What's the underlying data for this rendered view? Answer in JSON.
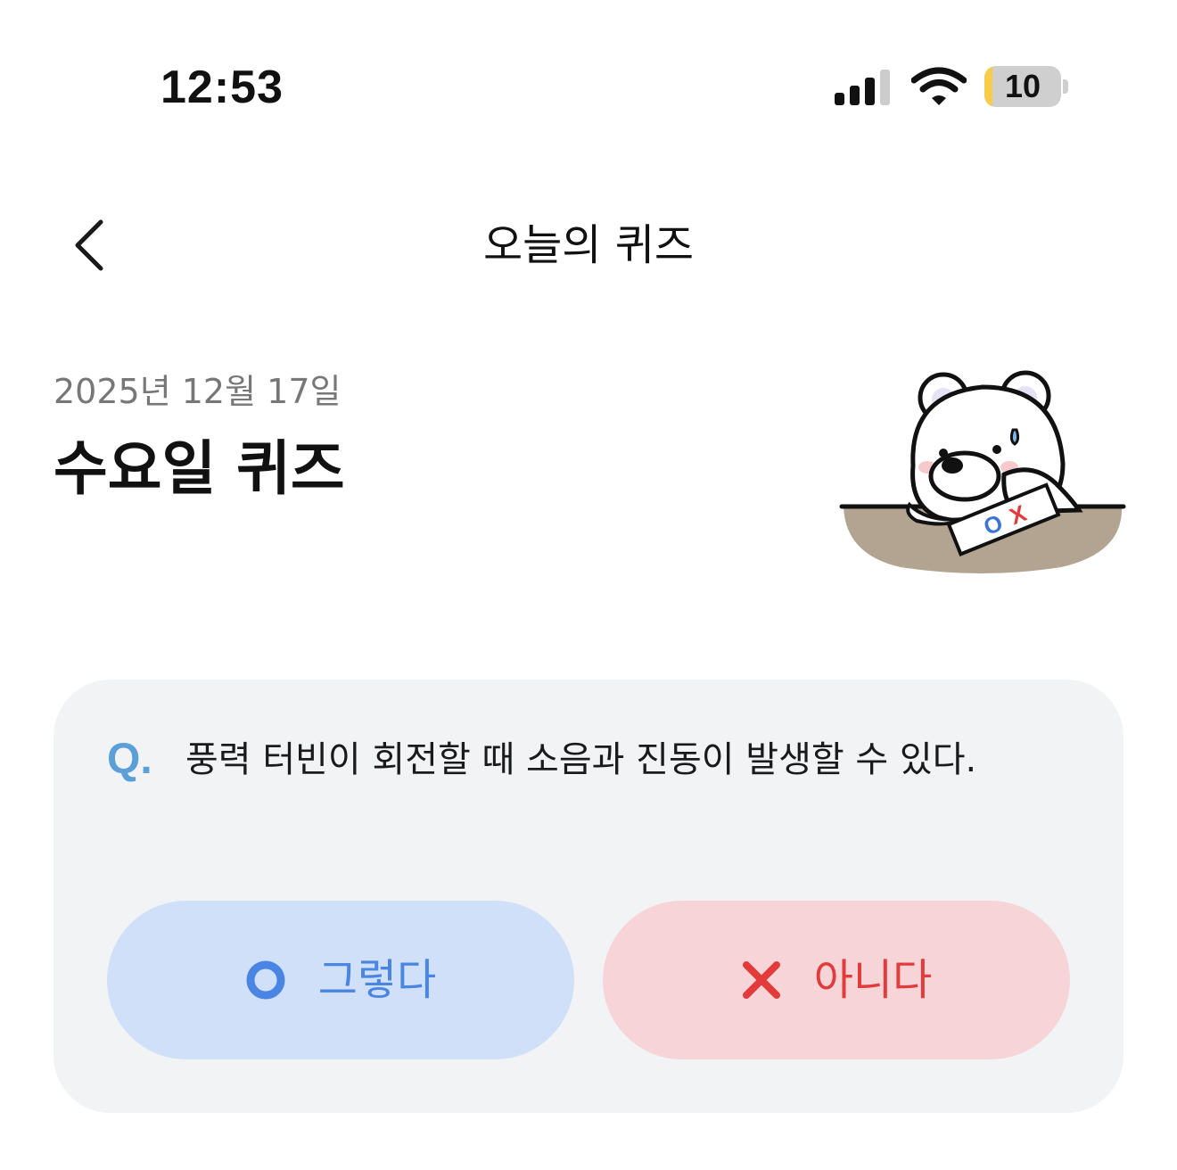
{
  "status_bar": {
    "time": "12:53",
    "battery_level": "10",
    "battery_fraction": 0.1,
    "icons": [
      "cellular-signal-icon",
      "wifi-icon",
      "battery-icon"
    ]
  },
  "header": {
    "title": "오늘의 퀴즈",
    "back_icon": "chevron-left-icon"
  },
  "quiz": {
    "date": "2025년 12월 17일",
    "title": "수요일 퀴즈",
    "mascot": "bear-mascot-illustration",
    "mascot_card_text": "OX"
  },
  "question": {
    "prefix": "Q.",
    "text": "풍력 터빈이 회전할 때 소음과 진동이 발생할 수 있다."
  },
  "answers": {
    "yes": {
      "icon": "circle-o-icon",
      "label": "그렇다",
      "color": "#4a85e4",
      "background": "#cfe0f8"
    },
    "no": {
      "icon": "x-mark-icon",
      "label": "아니다",
      "color": "#e23b3b",
      "background": "#f7d4d7"
    }
  },
  "colors": {
    "card_background": "#f2f3f5",
    "q_accent": "#5b9fd8",
    "date_gray": "#777777"
  }
}
